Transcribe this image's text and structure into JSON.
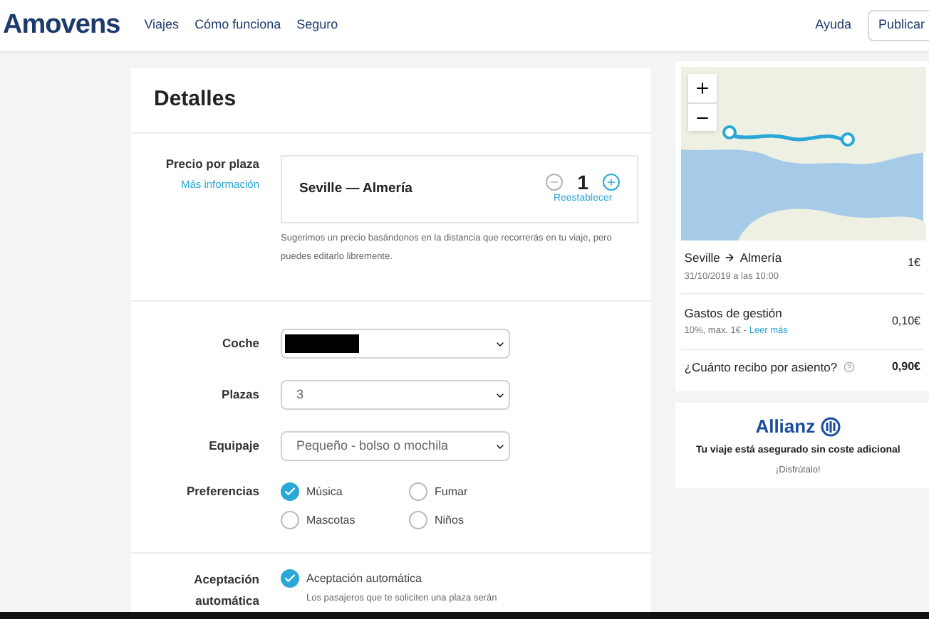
{
  "header": {
    "logo": "Amovens",
    "nav": [
      "Viajes",
      "Cómo funciona",
      "Seguro"
    ],
    "help": "Ayuda",
    "publish": "Publicar"
  },
  "details": {
    "title": "Detalles",
    "price": {
      "label": "Precio por plaza",
      "link": "Más información",
      "route": "Seville — Almería",
      "value": "1",
      "reset": "Reestablecer",
      "hint": "Sugerimos un precio basándonos en la distancia que recorrerás en tu viaje, pero puedes editarlo libremente."
    },
    "fields": [
      {
        "label": "Coche",
        "kind": "redacted"
      },
      {
        "label": "Plazas",
        "kind": "select",
        "value": "3"
      },
      {
        "label": "Equipaje",
        "kind": "select",
        "value": "Pequeño - bolso o mochila"
      }
    ],
    "preferences": {
      "label": "Preferencias",
      "options": [
        {
          "label": "Música",
          "checked": true
        },
        {
          "label": "Fumar",
          "checked": false
        },
        {
          "label": "Mascotas",
          "checked": false
        },
        {
          "label": "Niños",
          "checked": false
        }
      ]
    },
    "auto": {
      "label": "Aceptación automática",
      "option": "Aceptación automática",
      "checked": true,
      "description": "Los pasajeros que te soliciten una plaza serán"
    }
  },
  "summary": {
    "from": "Seville",
    "to": "Almería",
    "date": "31/10/2019 a las 10:00",
    "price": "1€",
    "fees_label": "Gastos de gestión",
    "fees_note": "10%, max. 1€ - ",
    "fees_link": "Leer más",
    "fees": "0,10€",
    "question": "¿Cuánto recibo por asiento?",
    "net": "0,90€"
  },
  "insurance": {
    "brand": "Allianz",
    "text": "Tu viaje está asegurado sin coste adicional",
    "note": "¡Disfrútalo!"
  }
}
